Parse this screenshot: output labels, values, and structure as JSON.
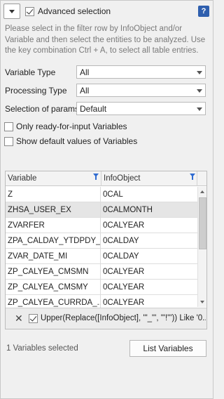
{
  "header": {
    "advanced_selection_label": "Advanced selection",
    "advanced_selection_checked": true,
    "help_label": "?"
  },
  "info_text": "Please select in the filter row by InfoObject and/or Variable and then select the entities to be analyzed. Use the key combination Ctrl + A, to select all table entries.",
  "fields": {
    "variable_type": {
      "label": "Variable Type",
      "value": "All"
    },
    "processing_type": {
      "label": "Processing Type",
      "value": "All"
    },
    "selection_of_params": {
      "label": "Selection of params.",
      "value": "Default"
    }
  },
  "checkboxes": {
    "only_ready": {
      "label": "Only ready-for-input Variables",
      "checked": false
    },
    "show_defaults": {
      "label": "Show default values of Variables",
      "checked": false
    }
  },
  "table": {
    "columns": [
      "Variable",
      "InfoObject"
    ],
    "rows": [
      {
        "variable": "Z",
        "infoobject": "0CAL",
        "selected": false
      },
      {
        "variable": "ZHSA_USER_EX",
        "infoobject": "0CALMONTH",
        "selected": true
      },
      {
        "variable": "ZVARFER",
        "infoobject": "0CALYEAR",
        "selected": false
      },
      {
        "variable": "ZPA_CALDAY_YTDPDY_...",
        "infoobject": "0CALDAY",
        "selected": false
      },
      {
        "variable": "ZVAR_DATE_MI",
        "infoobject": "0CALDAY",
        "selected": false
      },
      {
        "variable": "ZP_CALYEA_CMSMN",
        "infoobject": "0CALYEAR",
        "selected": false
      },
      {
        "variable": "ZP_CALYEA_CMSMY",
        "infoobject": "0CALYEAR",
        "selected": false
      },
      {
        "variable": "ZP_CALYEA_CURRDA_...",
        "infoobject": "0CALYEAR",
        "selected": false
      }
    ],
    "filter": {
      "checked": true,
      "close_symbol": "✕",
      "expression": "Upper(Replace([InfoObject], '\"_\"', '\"!\"')) Like '0..."
    }
  },
  "status_text": "1 Variables selected",
  "list_variables_label": "List Variables",
  "colors": {
    "accent": "#2f5fae",
    "selected_row": "#e5e5e5",
    "filter_icon": "#2f6bd1"
  }
}
